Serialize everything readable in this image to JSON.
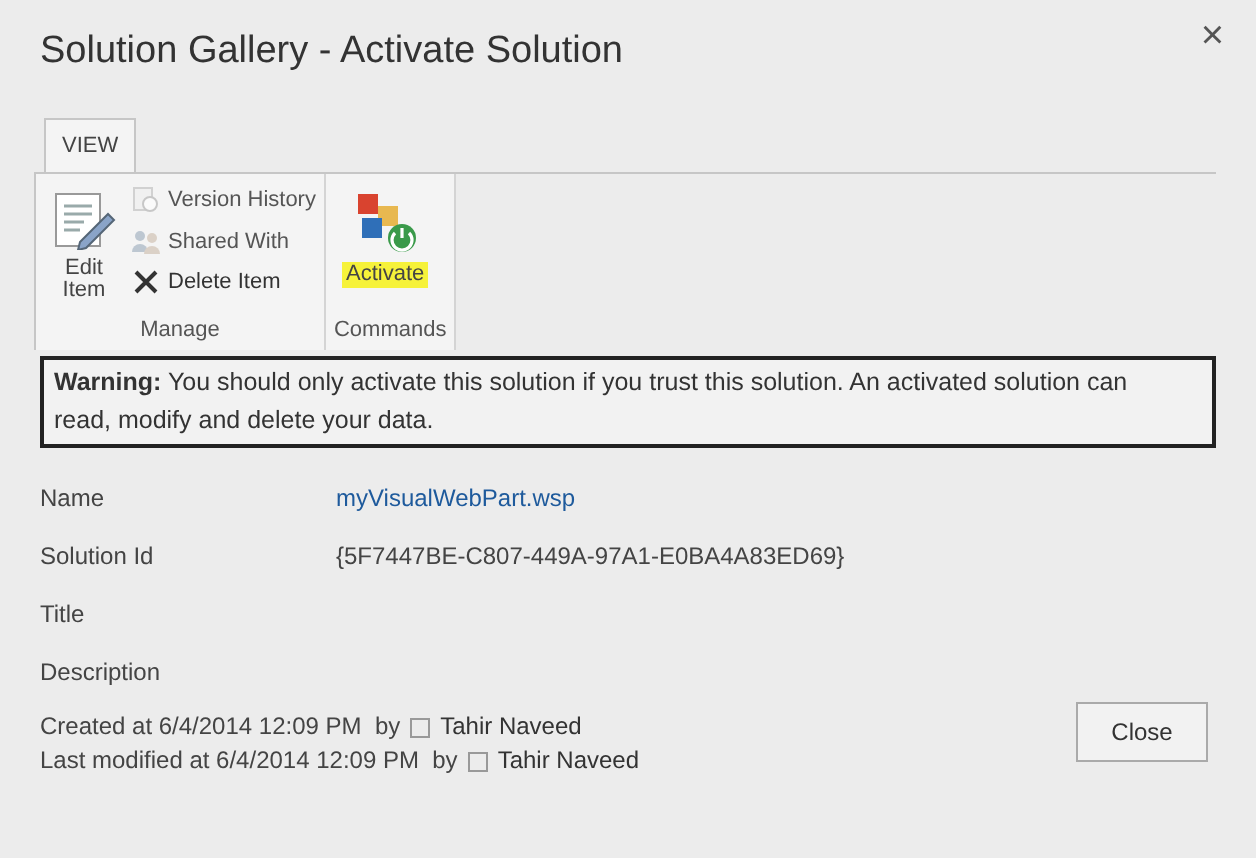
{
  "window": {
    "title": "Solution Gallery - Activate Solution",
    "close": "×"
  },
  "tabs": [
    {
      "label": "VIEW",
      "selected": true
    }
  ],
  "ribbon": {
    "groups": [
      {
        "label": "Manage",
        "large": [
          {
            "label": "Edit Item",
            "kind": "edit",
            "highlighted": false
          }
        ],
        "small": [
          {
            "label": "Version History",
            "kind": "history",
            "disabled": true
          },
          {
            "label": "Shared With",
            "kind": "shared",
            "disabled": true
          },
          {
            "label": "Delete Item",
            "kind": "delete",
            "disabled": false
          }
        ]
      },
      {
        "label": "Commands",
        "large": [
          {
            "label": "Activate",
            "kind": "activate",
            "highlighted": true
          }
        ]
      }
    ]
  },
  "warning": "**Warning:** You should only activate this solution if you trust this solution. An activated solution can read, modify and delete your data.",
  "fields": [
    {
      "label": "Name",
      "value": "myVisualWebPart.wsp",
      "kind": "link"
    },
    {
      "label": "Solution Id",
      "value": "{5F7447BE-C807-449A-97A1-E0BA4A83ED69}",
      "kind": "text"
    },
    {
      "label": "Title"
    },
    {
      "label": "Description"
    }
  ],
  "footer": [
    {
      "text": "Created at 6/4/2014 12:09 PM  by",
      "user": "Tahir Naveed"
    },
    {
      "text": "Last modified at 6/4/2014 12:09 PM  by",
      "user": "Tahir Naveed"
    }
  ],
  "buttons": [
    "Close"
  ]
}
